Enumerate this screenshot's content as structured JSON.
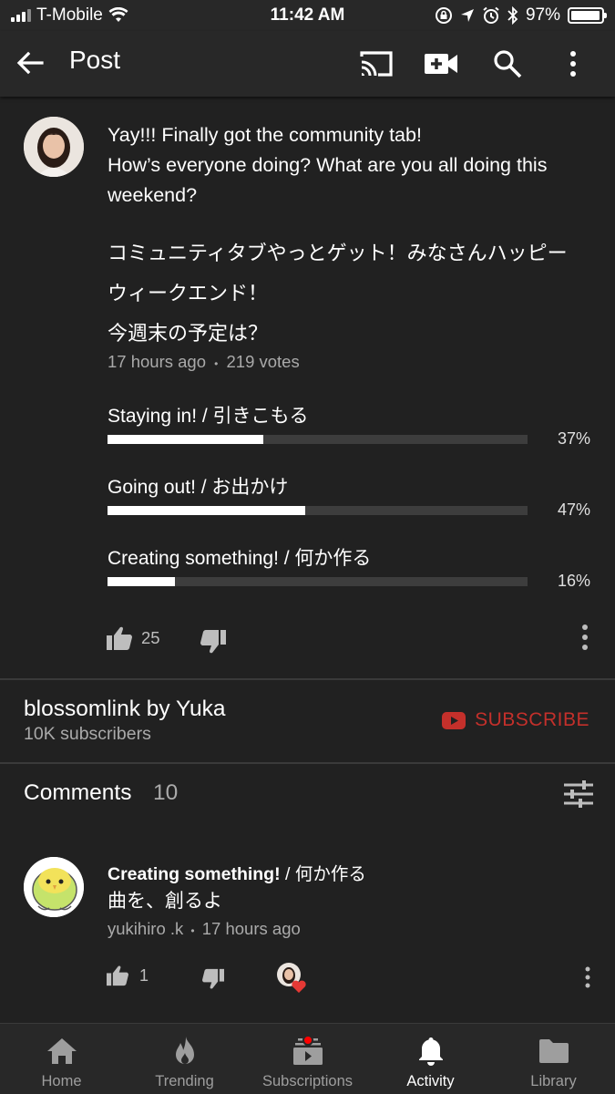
{
  "status_bar": {
    "carrier": "T-Mobile",
    "time": "11:42 AM",
    "battery": "97%",
    "battery_level": 0.97
  },
  "app_bar": {
    "title": "Post",
    "icons": [
      "back-arrow-icon",
      "cast-icon",
      "video-camera-add-icon",
      "search-icon",
      "more-vert-icon"
    ]
  },
  "post": {
    "text_en": "Yay!!! Finally got the community tab!\nHow’s everyone doing? What are you all doing this weekend?",
    "text_jp_line1": "コミュニティタブやっとゲット！みなさんハッピー",
    "text_jp_line2": "ウィークエンド！",
    "text_jp_line3": "今週末の予定は？",
    "time_ago": "17 hours ago",
    "separator": "•",
    "votes": "219 votes",
    "poll": [
      {
        "label": "Staying in! / 引きこもる",
        "percent_label": "37%",
        "value": 37
      },
      {
        "label": "Going out! / お出かけ",
        "percent_label": "47%",
        "value": 47
      },
      {
        "label": "Creating something! / 何か作る",
        "percent_label": "16%",
        "value": 16
      }
    ],
    "likes": "25"
  },
  "channel": {
    "name": "blossomlink by Yuka",
    "subscribers": "10K subscribers",
    "subscribe_label": "SUBSCRIBE",
    "subscribe_color": "#c4302b"
  },
  "comments": {
    "label": "Comments",
    "count": "10",
    "items": [
      {
        "choice": "Creating something!",
        "choice_rest": " / 何か作る",
        "text": "曲を、創るよ",
        "author": "yukihiro .k",
        "separator": "•",
        "time_ago": "17 hours ago",
        "likes": "1"
      }
    ]
  },
  "bottom_nav": [
    {
      "label": "Home",
      "icon": "home-icon"
    },
    {
      "label": "Trending",
      "icon": "flame-icon"
    },
    {
      "label": "Subscriptions",
      "icon": "subscriptions-icon",
      "badge": true
    },
    {
      "label": "Activity",
      "icon": "bell-icon",
      "active": true
    },
    {
      "label": "Library",
      "icon": "folder-icon"
    }
  ]
}
